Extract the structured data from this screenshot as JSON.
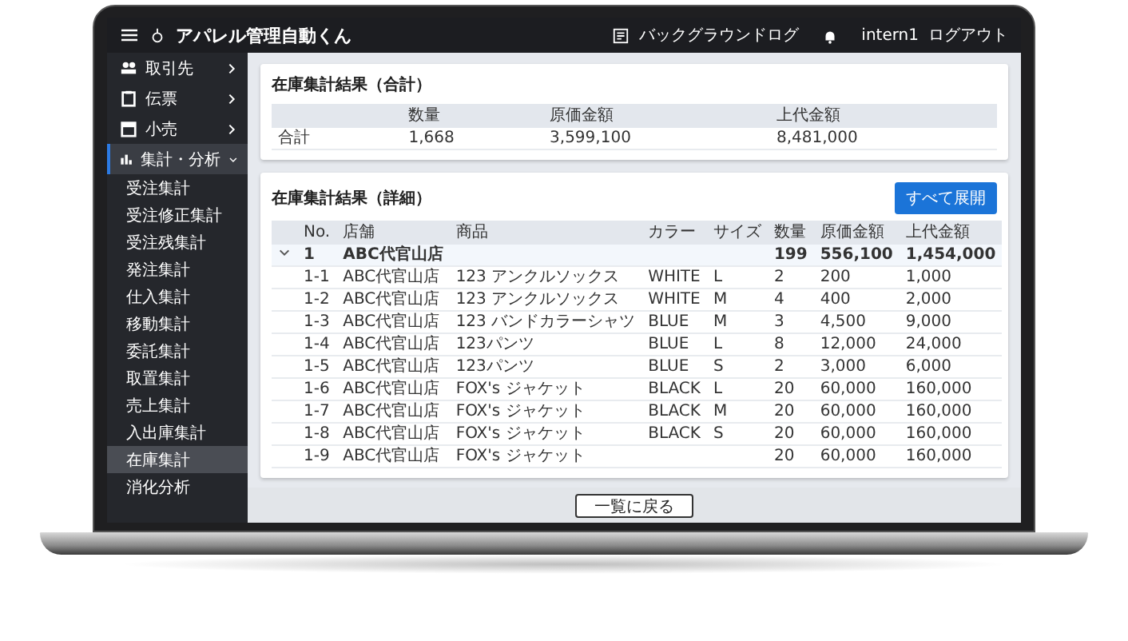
{
  "header": {
    "app_title": "アパレル管理自動くん",
    "background_log": "バックグラウンドログ",
    "user": "intern1",
    "logout": "ログアウト"
  },
  "sidebar": {
    "items": [
      {
        "label": "取引先",
        "expanded": false
      },
      {
        "label": "伝票",
        "expanded": false
      },
      {
        "label": "小売",
        "expanded": false
      },
      {
        "label": "集計・分析",
        "expanded": true,
        "children": [
          {
            "label": "受注集計",
            "selected": false
          },
          {
            "label": "受注修正集計",
            "selected": false
          },
          {
            "label": "受注残集計",
            "selected": false
          },
          {
            "label": "発注集計",
            "selected": false
          },
          {
            "label": "仕入集計",
            "selected": false
          },
          {
            "label": "移動集計",
            "selected": false
          },
          {
            "label": "委託集計",
            "selected": false
          },
          {
            "label": "取置集計",
            "selected": false
          },
          {
            "label": "売上集計",
            "selected": false
          },
          {
            "label": "入出庫集計",
            "selected": false
          },
          {
            "label": "在庫集計",
            "selected": true
          },
          {
            "label": "消化分析",
            "selected": false
          }
        ]
      }
    ]
  },
  "summary": {
    "title": "在庫集計結果（合計）",
    "columns": [
      "",
      "数量",
      "原価金額",
      "上代金額"
    ],
    "rows": [
      [
        "合計",
        "1,668",
        "3,599,100",
        "8,481,000"
      ]
    ]
  },
  "detail": {
    "title": "在庫集計結果（詳細）",
    "expand_all": "すべて展開",
    "columns": [
      "No.",
      "店舗",
      "商品",
      "カラー",
      "サイズ",
      "数量",
      "原価金額",
      "上代金額"
    ],
    "groups": [
      {
        "no": "1",
        "store": "ABC代官山店",
        "qty": "199",
        "cost": "556,100",
        "retail": "1,454,000",
        "expanded": true,
        "rows": [
          [
            "1-1",
            "ABC代官山店",
            "123 アンクルソックス",
            "WHITE",
            "L",
            "2",
            "200",
            "1,000"
          ],
          [
            "1-2",
            "ABC代官山店",
            "123 アンクルソックス",
            "WHITE",
            "M",
            "4",
            "400",
            "2,000"
          ],
          [
            "1-3",
            "ABC代官山店",
            "123 バンドカラーシャツ",
            "BLUE",
            "M",
            "3",
            "4,500",
            "9,000"
          ],
          [
            "1-4",
            "ABC代官山店",
            "123パンツ",
            "BLUE",
            "L",
            "8",
            "12,000",
            "24,000"
          ],
          [
            "1-5",
            "ABC代官山店",
            "123パンツ",
            "BLUE",
            "S",
            "2",
            "3,000",
            "6,000"
          ],
          [
            "1-6",
            "ABC代官山店",
            "FOX's ジャケット",
            "BLACK",
            "L",
            "20",
            "60,000",
            "160,000"
          ],
          [
            "1-7",
            "ABC代官山店",
            "FOX's ジャケット",
            "BLACK",
            "M",
            "20",
            "60,000",
            "160,000"
          ],
          [
            "1-8",
            "ABC代官山店",
            "FOX's ジャケット",
            "BLACK",
            "S",
            "20",
            "60,000",
            "160,000"
          ],
          [
            "1-9",
            "ABC代官山店",
            "FOX's ジャケット",
            null,
            null,
            "20",
            "60,000",
            "160,000"
          ]
        ]
      }
    ]
  },
  "footer": {
    "back": "一覧に戻る"
  }
}
